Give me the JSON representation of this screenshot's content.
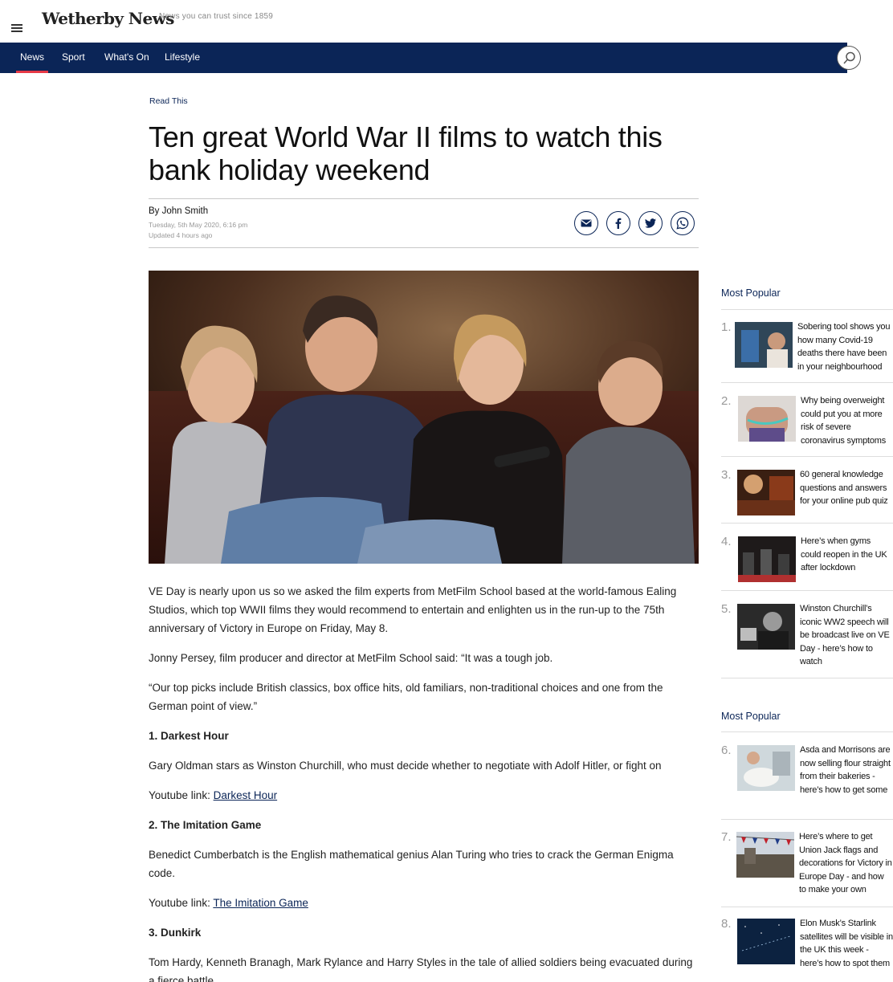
{
  "header": {
    "brand": "Wetherby News",
    "tagline": "News you can trust since 1859"
  },
  "nav": {
    "items": [
      {
        "label": "News"
      },
      {
        "label": "Sport"
      },
      {
        "label": "What's On"
      },
      {
        "label": "Lifestyle"
      }
    ],
    "active": "News"
  },
  "article": {
    "section": "Read This",
    "title": "Ten great World War II films to watch this bank holiday weekend",
    "byline_prefix": "By",
    "author": "John Smith",
    "published": "Tuesday, 5th May 2020, 6:16 pm",
    "updated": "Updated  4 hours ago",
    "paragraphs": {
      "p1": "VE Day is nearly upon us so we asked the film experts from MetFilm School based at the world-famous Ealing Studios, which top WWII films they would recommend to entertain and enlighten us in the run-up to the 75th anniversary of Victory in Europe on Friday, May 8.",
      "p2": "Jonny Persey, film producer and director at MetFilm School said: “It was a tough job.",
      "p3": "“Our top picks include British classics, box office hits, old familiars, non-traditional choices and one from the German point of view.”",
      "h1": "1. Darkest Hour",
      "p4": "Gary Oldman stars as Winston Churchill, who must decide whether to negotiate with Adolf Hitler, or fight on",
      "link_prefix": "Youtube link:",
      "link1": "Darkest Hour",
      "h2": "2. The Imitation Game",
      "p5": "Benedict Cumberbatch is the English mathematical genius Alan Turing who tries to crack the German Enigma code.",
      "link2": "The Imitation Game",
      "h3": "3. Dunkirk",
      "p6": "Tom Hardy, Kenneth Branagh, Mark Rylance and Harry Styles in the tale of allied soldiers being evacuated during a fierce battle."
    }
  },
  "sidebar": {
    "section1_title": "Most Popular",
    "section2_title": "Most Popular",
    "items": [
      {
        "num": "1.",
        "text": "Sobering tool shows you how many Covid-19 deaths there have been in your neighbourhood"
      },
      {
        "num": "2.",
        "text": "Why being overweight could put you at more risk of severe coronavirus symptoms"
      },
      {
        "num": "3.",
        "text": "60 general knowledge questions and answers for your online pub quiz"
      },
      {
        "num": "4.",
        "text": "Here’s when gyms could reopen in the UK after lockdown"
      },
      {
        "num": "5.",
        "text": "Winston Churchill’s iconic WW2 speech will be broadcast live on VE Day - here’s how to watch"
      },
      {
        "num": "6.",
        "text": "Asda and Morrisons are now selling flour straight from their bakeries - here’s how to get some"
      },
      {
        "num": "7.",
        "text": "Here’s where to get Union Jack flags and decorations for Victory in Europe Day - and how to make your own"
      },
      {
        "num": "8.",
        "text": "Elon Musk’s Starlink satellites will be visible in the UK this week - here’s how to spot them"
      }
    ]
  },
  "colors": {
    "nav_bg": "#0b2557",
    "accent": "#e63946",
    "link": "#0b2557"
  },
  "icons": [
    "menu-icon",
    "search-icon",
    "email-icon",
    "facebook-icon",
    "twitter-icon",
    "whatsapp-icon"
  ]
}
